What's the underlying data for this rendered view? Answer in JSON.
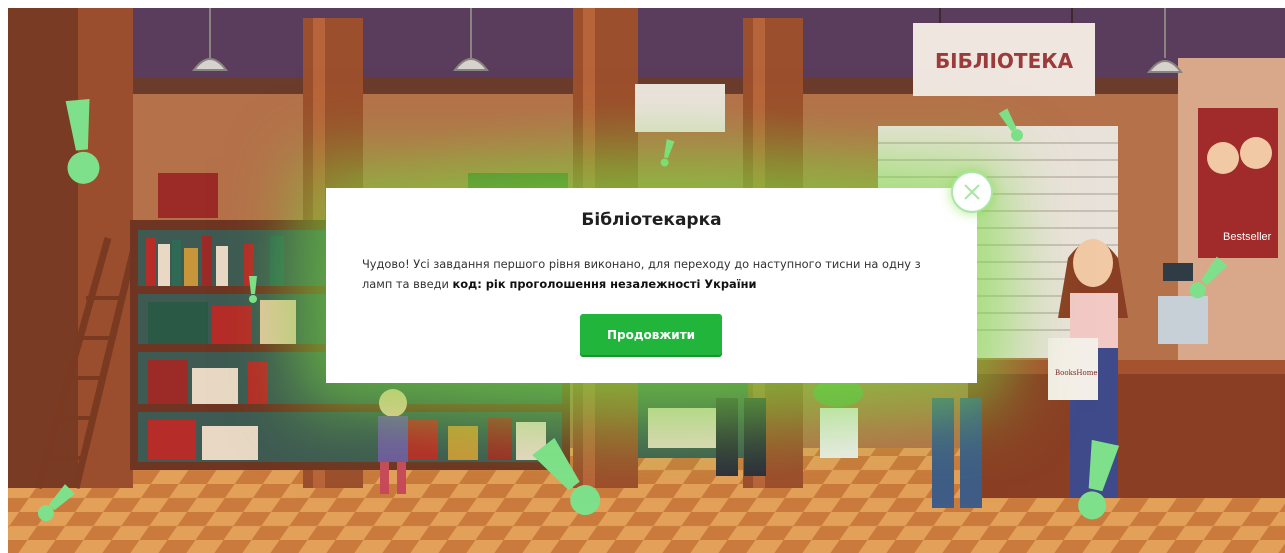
{
  "scene": {
    "sign_text": "БІБЛІОТЕКА",
    "poster_text": "Bestseller",
    "bag_text": "BooksHome"
  },
  "modal": {
    "title": "Бібліотекарка",
    "text_plain": "Чудово! Усі завдання першого рівня виконано, для переходу до наступного тисни на одну з ламп та введи ",
    "text_bold": "код: рік проголошення незалежності України",
    "button_label": "Продовжити"
  },
  "icons": {
    "close": "close-icon",
    "hint": "exclamation-icon"
  },
  "colors": {
    "accent": "#21b53b",
    "hint": "#7ee08a",
    "wall": "#b06a3c",
    "floor_light": "#d9914a",
    "floor_dark": "#a45a2a"
  }
}
